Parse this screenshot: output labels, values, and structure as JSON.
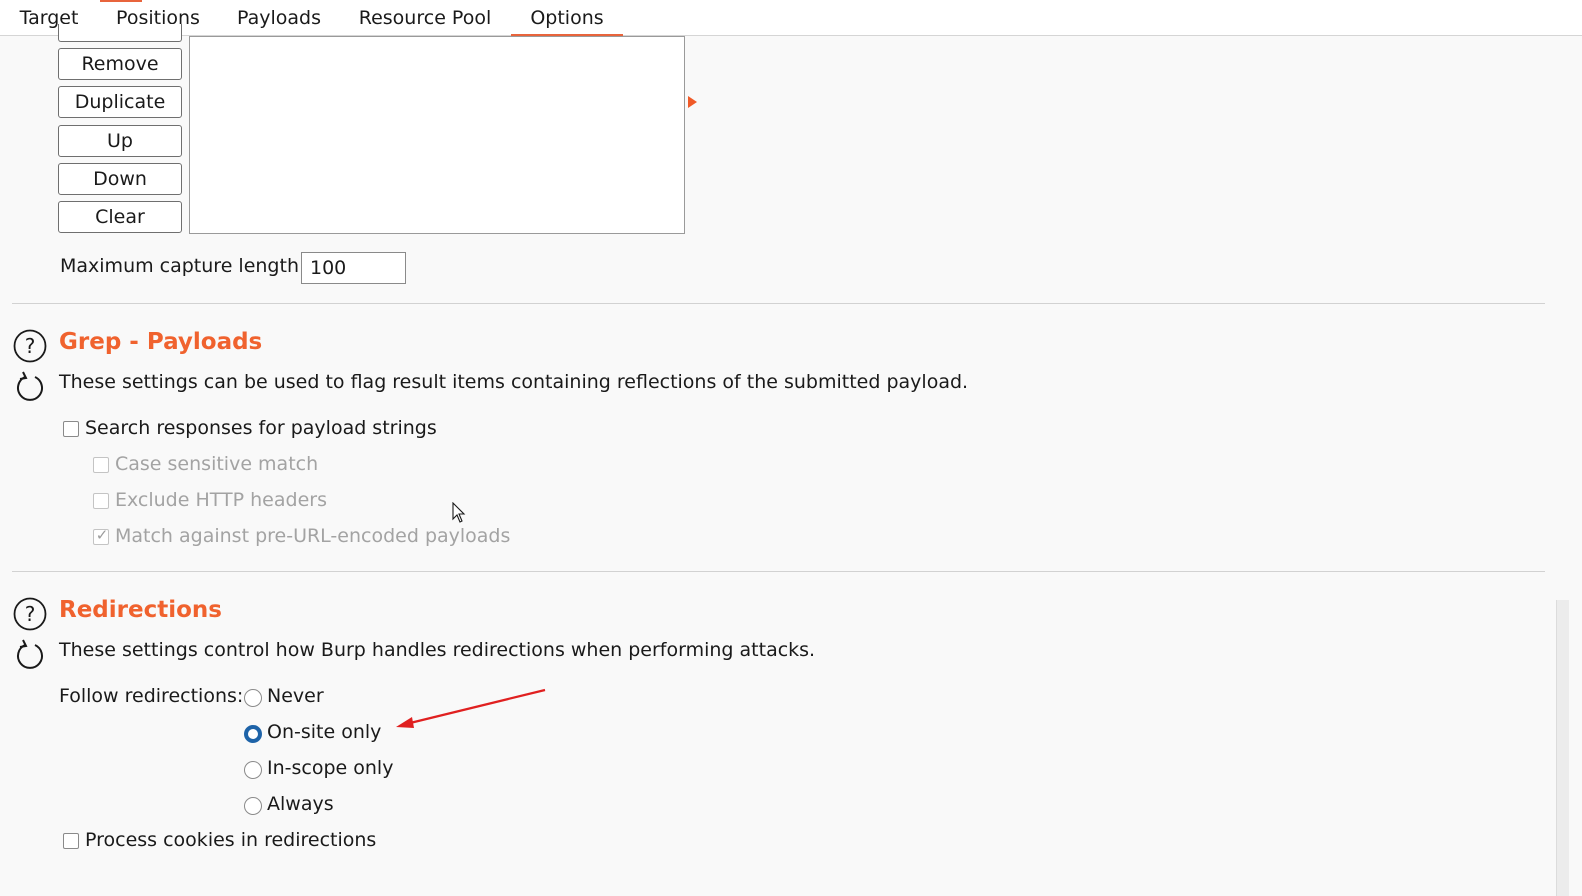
{
  "tabs": {
    "target": "Target",
    "positions": "Positions",
    "payloads": "Payloads",
    "resource_pool": "Resource Pool",
    "options": "Options",
    "active": "Options",
    "accent_color": "#e8643c"
  },
  "extract_buttons": {
    "remove": "Remove",
    "duplicate": "Duplicate",
    "up": "Up",
    "down": "Down",
    "clear": "Clear"
  },
  "capture": {
    "label": "Maximum capture length:",
    "value": "100"
  },
  "grep_payloads": {
    "title": "Grep - Payloads",
    "description": "These settings can be used to flag result items containing reflections of the submitted payload.",
    "search_responses": {
      "label": "Search responses for payload strings",
      "checked": false,
      "enabled": true
    },
    "case_sensitive": {
      "label": "Case sensitive match",
      "checked": false,
      "enabled": false
    },
    "exclude_headers": {
      "label": "Exclude HTTP headers",
      "checked": false,
      "enabled": false
    },
    "match_pre_url": {
      "label": "Match against pre-URL-encoded payloads",
      "checked": true,
      "enabled": false
    }
  },
  "redirections": {
    "title": "Redirections",
    "description": "These settings control how Burp handles redirections when performing attacks.",
    "follow_label": "Follow redirections:",
    "options": [
      "Never",
      "On-site only",
      "In-scope only",
      "Always"
    ],
    "selected": "On-site only",
    "process_cookies": {
      "label": "Process cookies in redirections",
      "checked": false
    }
  },
  "icons": {
    "help": "help-icon",
    "refresh": "refresh-icon"
  },
  "colors": {
    "section_title": "#f0622e",
    "radio_selected": "#1e63a8",
    "annotation_arrow": "#e02020"
  }
}
